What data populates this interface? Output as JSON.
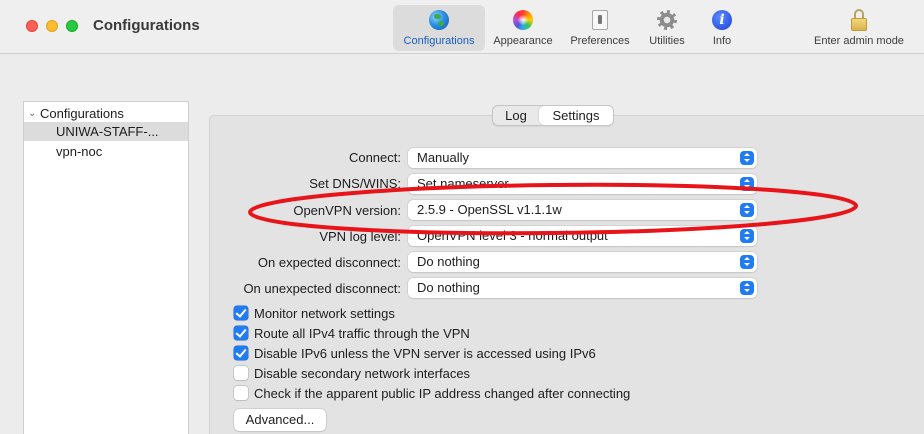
{
  "window": {
    "title": "Configurations",
    "traffic_lights": [
      "close",
      "minimize",
      "zoom"
    ]
  },
  "toolbar": {
    "items": [
      {
        "label": "Configurations",
        "icon": "globe-icon",
        "active": true
      },
      {
        "label": "Appearance",
        "icon": "color-wheel-icon"
      },
      {
        "label": "Preferences",
        "icon": "switch-icon"
      },
      {
        "label": "Utilities",
        "icon": "gear-icon"
      },
      {
        "label": "Info",
        "icon": "info-icon"
      }
    ],
    "admin_label": "Enter admin mode",
    "admin_icon": "lock-icon"
  },
  "sidebar": {
    "root_label": "Configurations",
    "items": [
      {
        "label": "UNIWA-STAFF-...",
        "selected": true
      },
      {
        "label": "vpn-noc",
        "selected": false
      }
    ]
  },
  "tabs": {
    "log": "Log",
    "settings": "Settings",
    "selected": "Settings"
  },
  "settings": {
    "connect": {
      "label": "Connect:",
      "value": "Manually"
    },
    "dns": {
      "label": "Set DNS/WINS:",
      "value": "Set nameserver"
    },
    "openvpn_version": {
      "label": "OpenVPN version:",
      "value": "2.5.9 - OpenSSL v1.1.1w"
    },
    "log_level": {
      "label": "VPN log level:",
      "value": "OpenVPN level 3 - normal output"
    },
    "expected_disconnect": {
      "label": "On expected disconnect:",
      "value": "Do nothing"
    },
    "unexpected_disconnect": {
      "label": "On unexpected disconnect:",
      "value": "Do nothing"
    }
  },
  "checkboxes": [
    {
      "label": "Monitor network settings",
      "checked": true
    },
    {
      "label": "Route all IPv4 traffic through the VPN",
      "checked": true
    },
    {
      "label": "Disable IPv6 unless the VPN server is accessed using IPv6",
      "checked": true
    },
    {
      "label": "Disable secondary network interfaces",
      "checked": false
    },
    {
      "label": "Check if the apparent public IP address changed after connecting",
      "checked": false
    }
  ],
  "advanced_button": "Advanced...",
  "colors": {
    "accent": "#1f7cf2",
    "annotation": "#e8141a",
    "active_toolbar_text": "#1a5fc2"
  }
}
